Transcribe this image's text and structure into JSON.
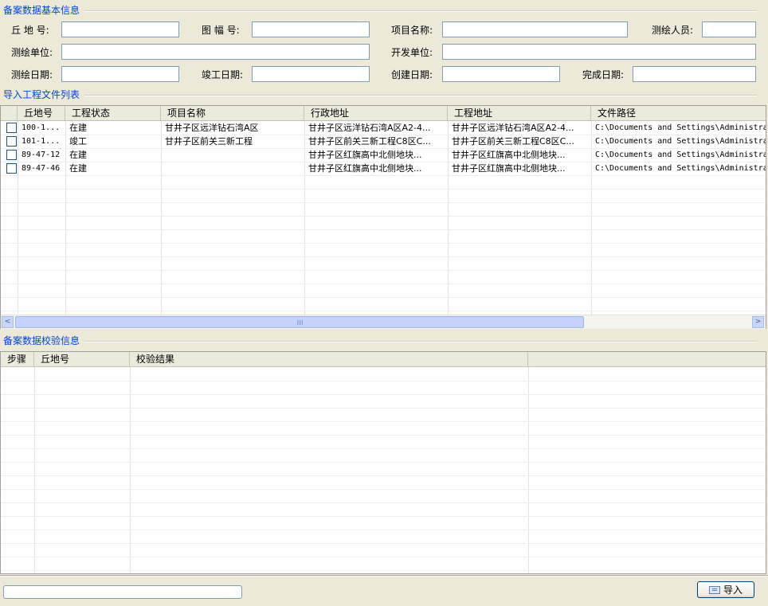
{
  "basic_info": {
    "title": "备案数据基本信息",
    "fields": {
      "qiudi_label": "丘 地 号:",
      "tufu_label": "图 幅 号:",
      "project_name_label": "项目名称:",
      "surveyor_label": "测绘人员:",
      "survey_unit_label": "测绘单位:",
      "developer_label": "开发单位:",
      "survey_date_label": "测绘日期:",
      "completion_date_label": "竣工日期:",
      "create_date_label": "创建日期:",
      "finish_date_label": "完成日期:"
    },
    "values": {
      "qiudi": "",
      "tufu": "",
      "project_name": "",
      "surveyor": "",
      "survey_unit": "",
      "developer": "",
      "survey_date": "",
      "completion_date": "",
      "create_date": "",
      "finish_date": ""
    }
  },
  "file_list": {
    "title": "导入工程文件列表",
    "columns": [
      "丘地号",
      "工程状态",
      "项目名称",
      "行政地址",
      "工程地址",
      "文件路径"
    ],
    "rows": [
      {
        "checked": false,
        "qiudi": "100-1...",
        "status": "在建",
        "project": "甘井子区远洋钻石湾A区",
        "admin_addr": "甘井子区远洋钻石湾A区A2-4...",
        "proj_addr": "甘井子区远洋钻石湾A区A2-4...",
        "path": "C:\\Documents and Settings\\Administra"
      },
      {
        "checked": false,
        "qiudi": "101-1...",
        "status": "竣工",
        "project": "甘井子区前关三新工程",
        "admin_addr": "甘井子区前关三新工程C8区C...",
        "proj_addr": "甘井子区前关三新工程C8区C...",
        "path": "C:\\Documents and Settings\\Administra"
      },
      {
        "checked": false,
        "qiudi": "89-47-12",
        "status": "在建",
        "project": "",
        "admin_addr": "甘井子区红旗高中北侧地块...",
        "proj_addr": "甘井子区红旗高中北侧地块...",
        "path": "C:\\Documents and Settings\\Administra"
      },
      {
        "checked": false,
        "qiudi": "89-47-46",
        "status": "在建",
        "project": "",
        "admin_addr": "甘井子区红旗高中北侧地块...",
        "proj_addr": "甘井子区红旗高中北侧地块...",
        "path": "C:\\Documents and Settings\\Administra"
      }
    ]
  },
  "validation": {
    "title": "备案数据校验信息",
    "columns": [
      "步骤",
      "丘地号",
      "校验结果"
    ]
  },
  "scrollbar": {
    "left_arrow": "<",
    "right_arrow": ">"
  },
  "footer": {
    "import_label": "导入"
  },
  "colors": {
    "group_title": "#0046D5",
    "window_bg": "#ECE9D8",
    "input_border": "#7F9DB9"
  }
}
